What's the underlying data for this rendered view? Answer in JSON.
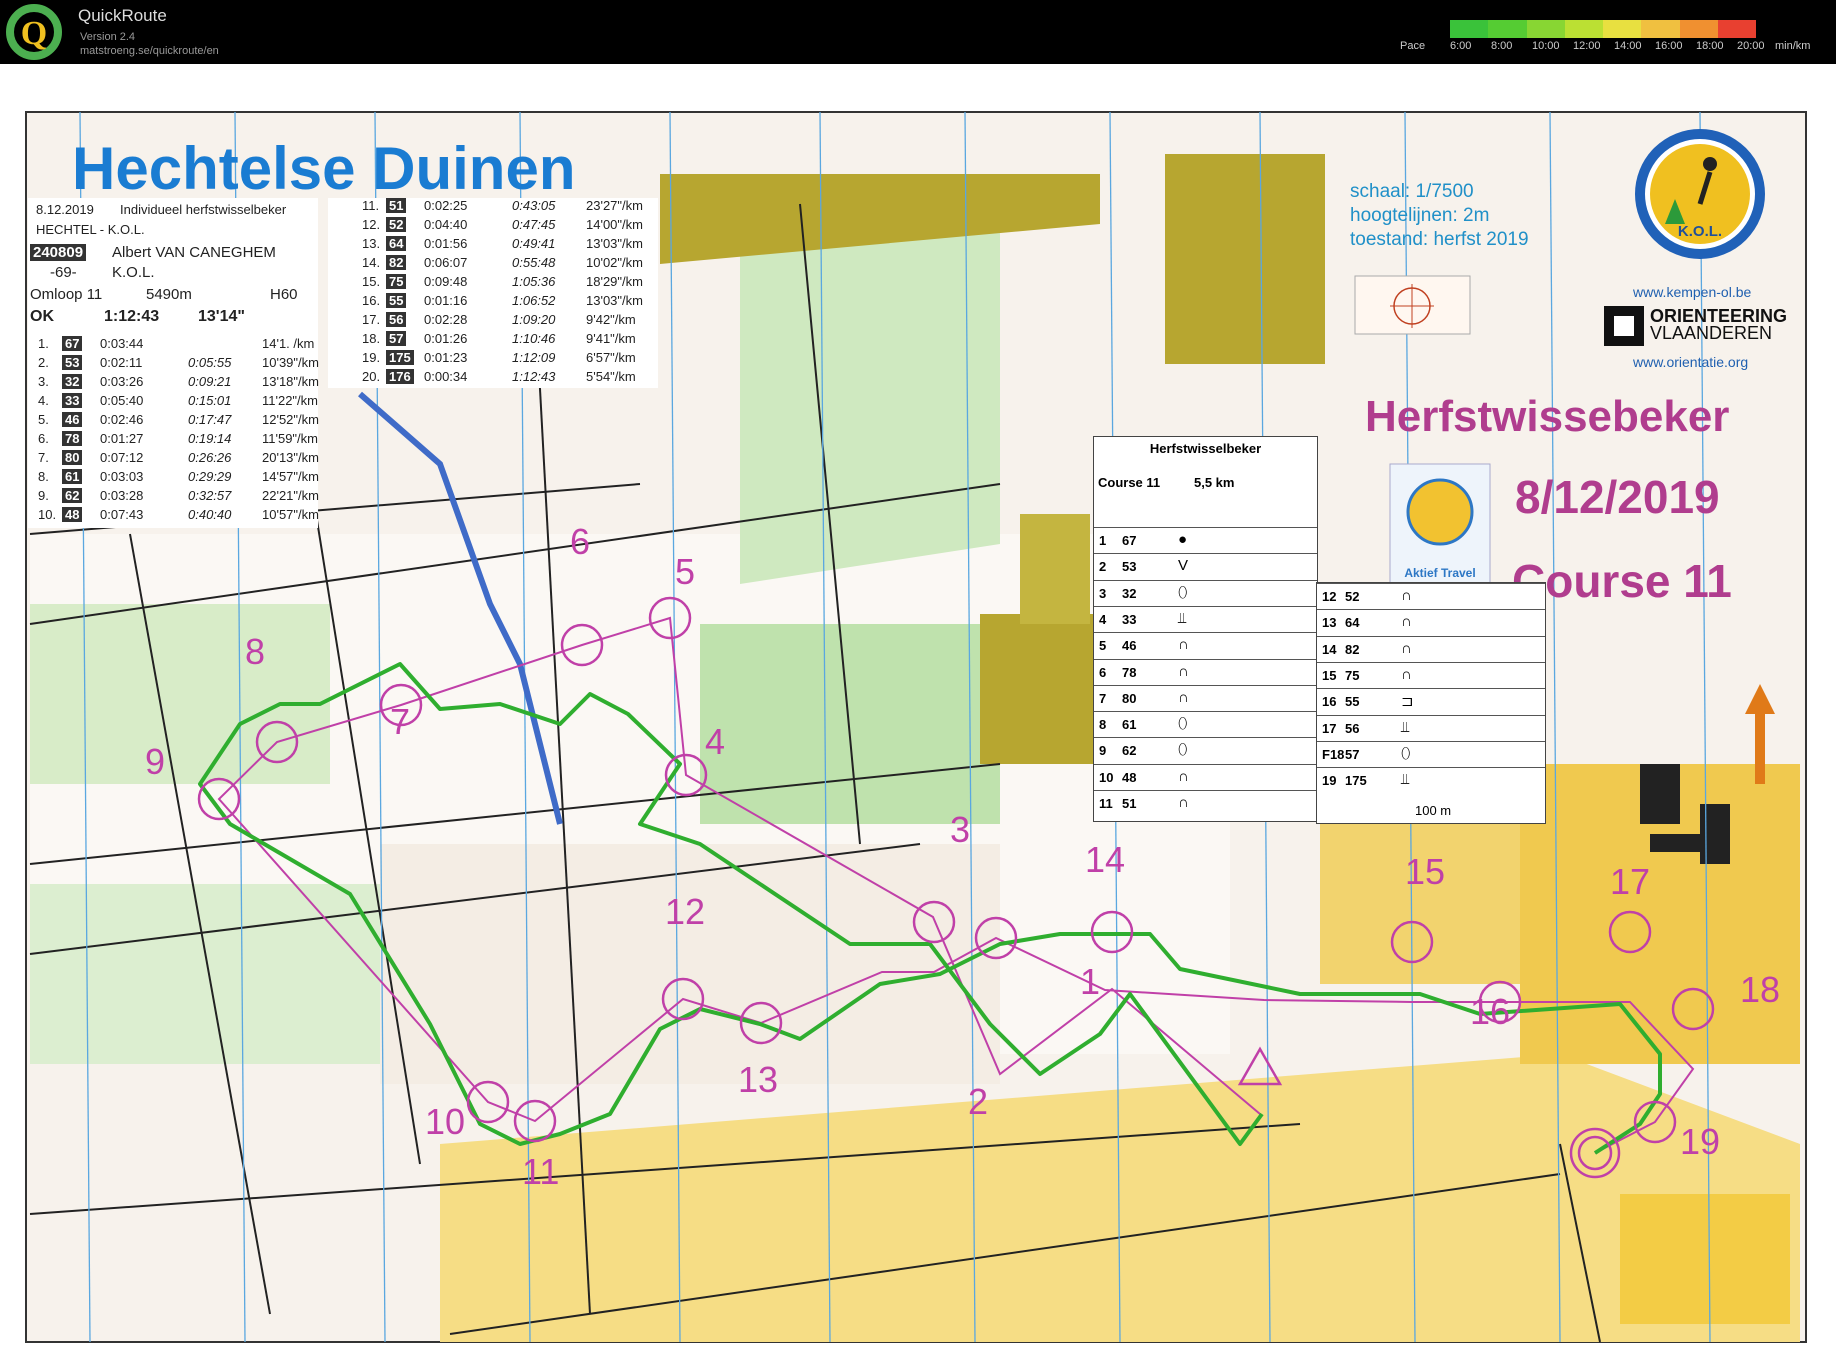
{
  "app": {
    "title": "QuickRoute",
    "version": "Version 2.4",
    "url": "matstroeng.se/quickroute/en",
    "logo_letter": "Q"
  },
  "pace_legend": {
    "label": "Pace",
    "ticks": [
      "6:00",
      "8:00",
      "10:00",
      "12:00",
      "14:00",
      "16:00",
      "18:00",
      "20:00"
    ],
    "unit": "min/km",
    "colors": [
      "#3ac23a",
      "#55cc33",
      "#88d633",
      "#bbe033",
      "#e8e040",
      "#f0c040",
      "#f09030",
      "#e84030"
    ]
  },
  "map": {
    "title": "Hechtelse Duinen",
    "info": [
      "schaal: 1/7500",
      "hoogtelijnen: 2m",
      "toestand: herfst 2019"
    ],
    "logos": {
      "kol": "K.O.L.",
      "kol_url": "www.kempen-ol.be",
      "ov_line1": "ORIENTEERING",
      "ov_line2": "VLAANDEREN",
      "ov_url": "www.orientatie.org"
    },
    "event_name": "Herfstwissebeker",
    "event_date": "8/12/2019",
    "event_course": "Course 11",
    "control_labels": [
      "4",
      "5",
      "6",
      "7",
      "8",
      "9",
      "10",
      "11",
      "12",
      "13",
      "14",
      "15",
      "16",
      "17",
      "18",
      "19",
      "1",
      "2",
      "3"
    ]
  },
  "split_card": {
    "date": "8.12.2019",
    "event": "Individueel herfstwisselbeker",
    "club_event": "HECHTEL - K.O.L.",
    "runner_id": "240809",
    "runner": "Albert VAN CANEGHEM",
    "runner_code": "-69-",
    "runner_club": "K.O.L.",
    "course": "Omloop  11",
    "distance": "5490m",
    "category": "H60",
    "status": "OK",
    "total_time": "1:12:43",
    "avg_pace": "13'14\"",
    "splits_left": [
      {
        "n": "1.",
        "code": "67",
        "leg": "0:03:44",
        "total": "",
        "pace": "14'1.  /km"
      },
      {
        "n": "2.",
        "code": "53",
        "leg": "0:02:11",
        "total": "0:05:55",
        "pace": "10'39\"/km"
      },
      {
        "n": "3.",
        "code": "32",
        "leg": "0:03:26",
        "total": "0:09:21",
        "pace": "13'18\"/km"
      },
      {
        "n": "4.",
        "code": "33",
        "leg": "0:05:40",
        "total": "0:15:01",
        "pace": "11'22\"/km"
      },
      {
        "n": "5.",
        "code": "46",
        "leg": "0:02:46",
        "total": "0:17:47",
        "pace": "12'52\"/km"
      },
      {
        "n": "6.",
        "code": "78",
        "leg": "0:01:27",
        "total": "0:19:14",
        "pace": "11'59\"/km"
      },
      {
        "n": "7.",
        "code": "80",
        "leg": "0:07:12",
        "total": "0:26:26",
        "pace": "20'13\"/km"
      },
      {
        "n": "8.",
        "code": "61",
        "leg": "0:03:03",
        "total": "0:29:29",
        "pace": "14'57\"/km"
      },
      {
        "n": "9.",
        "code": "62",
        "leg": "0:03:28",
        "total": "0:32:57",
        "pace": "22'21\"/km"
      },
      {
        "n": "10.",
        "code": "48",
        "leg": "0:07:43",
        "total": "0:40:40",
        "pace": "10'57\"/km"
      }
    ],
    "splits_right": [
      {
        "n": "11.",
        "code": "51",
        "leg": "0:02:25",
        "total": "0:43:05",
        "pace": "23'27\"/km"
      },
      {
        "n": "12.",
        "code": "52",
        "leg": "0:04:40",
        "total": "0:47:45",
        "pace": "14'00\"/km"
      },
      {
        "n": "13.",
        "code": "64",
        "leg": "0:01:56",
        "total": "0:49:41",
        "pace": "13'03\"/km"
      },
      {
        "n": "14.",
        "code": "82",
        "leg": "0:06:07",
        "total": "0:55:48",
        "pace": "10'02\"/km"
      },
      {
        "n": "15.",
        "code": "75",
        "leg": "0:09:48",
        "total": "1:05:36",
        "pace": "18'29\"/km"
      },
      {
        "n": "16.",
        "code": "55",
        "leg": "0:01:16",
        "total": "1:06:52",
        "pace": "13'03\"/km"
      },
      {
        "n": "17.",
        "code": "56",
        "leg": "0:02:28",
        "total": "1:09:20",
        "pace": "9'42\"/km"
      },
      {
        "n": "18.",
        "code": "57",
        "leg": "0:01:26",
        "total": "1:10:46",
        "pace": "9'41\"/km"
      },
      {
        "n": "19.",
        "code": "175",
        "leg": "0:01:23",
        "total": "1:12:09",
        "pace": "6'57\"/km"
      },
      {
        "n": "20.",
        "code": "176",
        "leg": "0:00:34",
        "total": "1:12:43",
        "pace": "5'54\"/km"
      }
    ]
  },
  "control_description": {
    "title": "Herfstwisselbeker",
    "course": "Course 11",
    "length": "5,5 km",
    "rows_left": [
      {
        "n": "1",
        "code": "67",
        "sym": "●"
      },
      {
        "n": "2",
        "code": "53",
        "sym": "V"
      },
      {
        "n": "3",
        "code": "32",
        "sym": "⬯"
      },
      {
        "n": "4",
        "code": "33",
        "sym": "⫫"
      },
      {
        "n": "5",
        "code": "46",
        "sym": "∩"
      },
      {
        "n": "6",
        "code": "78",
        "sym": "∩"
      },
      {
        "n": "7",
        "code": "80",
        "sym": "∩"
      },
      {
        "n": "8",
        "code": "61",
        "sym": "⬯"
      },
      {
        "n": "9",
        "code": "62",
        "sym": "⬯"
      },
      {
        "n": "10",
        "code": "48",
        "sym": "∩"
      },
      {
        "n": "11",
        "code": "51",
        "sym": "∩"
      }
    ],
    "rows_right": [
      {
        "n": "12",
        "code": "52",
        "sym": "∩"
      },
      {
        "n": "13",
        "code": "64",
        "sym": "∩"
      },
      {
        "n": "14",
        "code": "82",
        "sym": "∩"
      },
      {
        "n": "15",
        "code": "75",
        "sym": "∩"
      },
      {
        "n": "16",
        "code": "55",
        "sym": "⊐"
      },
      {
        "n": "17",
        "code": "56",
        "sym": "⫫"
      },
      {
        "n": "F18",
        "code": "57",
        "sym": "⬯"
      },
      {
        "n": "19",
        "code": "175",
        "sym": "⫫"
      }
    ],
    "finish_text": "100 m",
    "sponsor_text": "Aktief Travel"
  }
}
